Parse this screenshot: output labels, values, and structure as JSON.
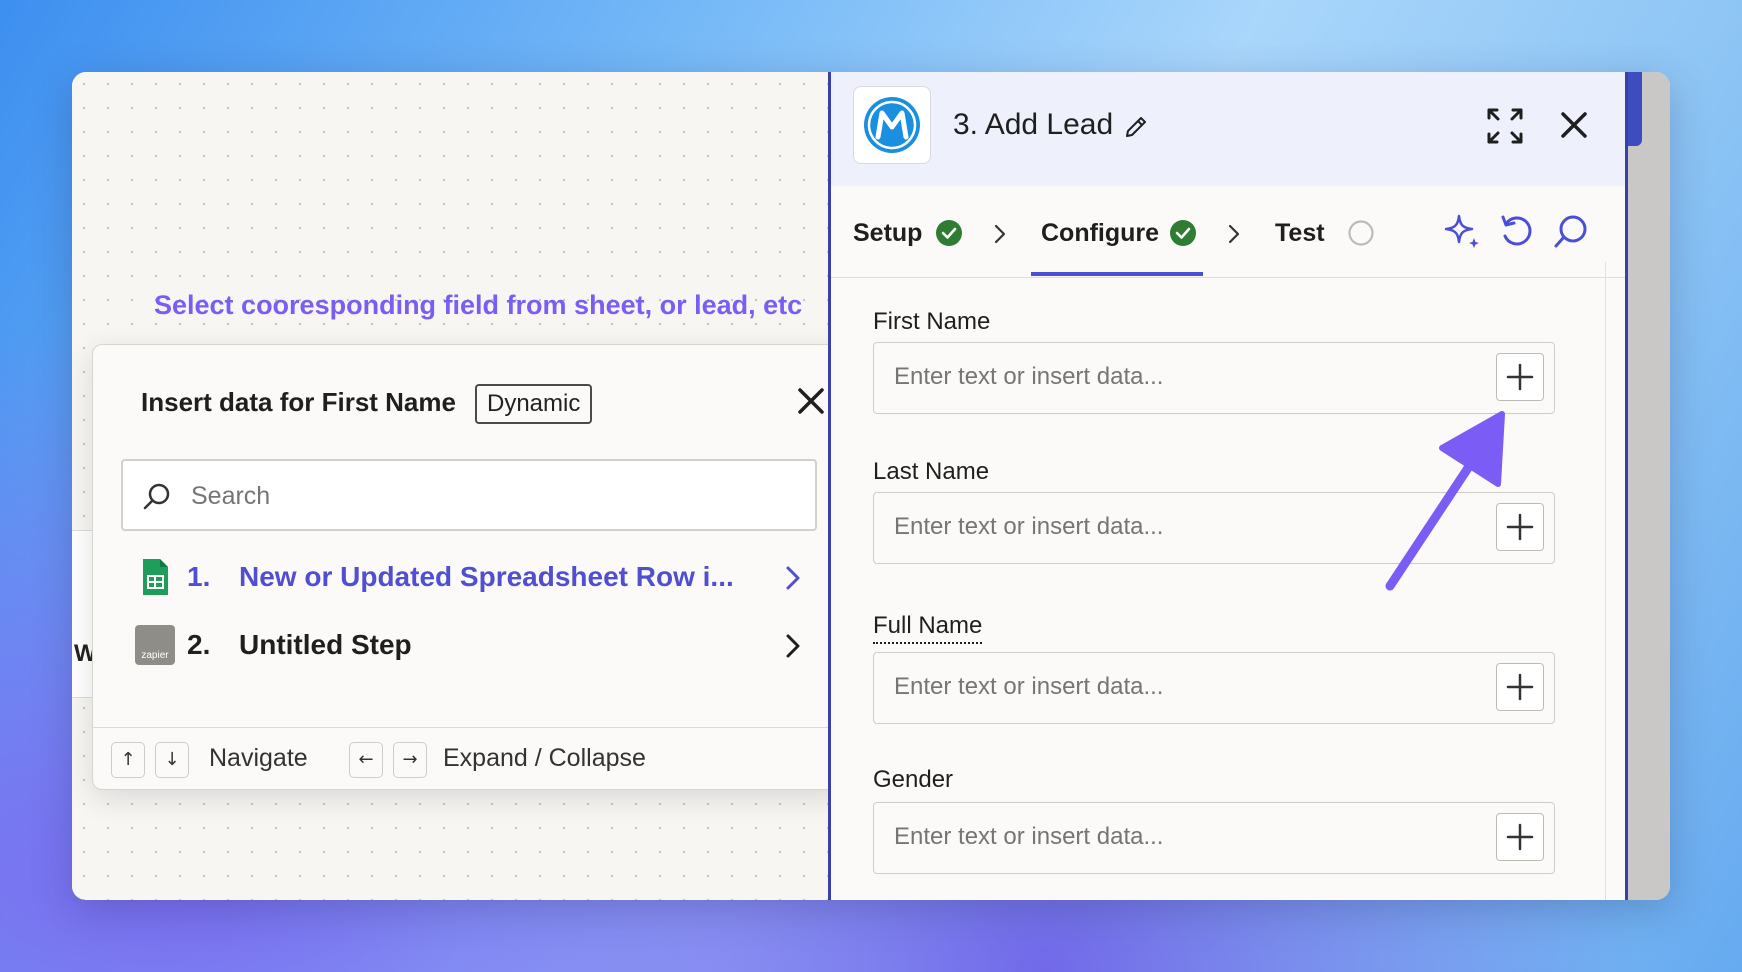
{
  "canvas": {
    "hint": "Select cooresponding field from sheet, or lead, etc",
    "stub_letter": "W"
  },
  "popup": {
    "title": "Insert data for First Name",
    "badge": "Dynamic",
    "search_placeholder": "Search",
    "items": [
      {
        "number": "1.",
        "label": "New or Updated Spreadsheet Row i...",
        "icon": "google-sheets-icon",
        "color": "#4f4fd0"
      },
      {
        "number": "2.",
        "label": "Untitled Step",
        "icon": "zapier-icon",
        "icon_text": "zapier",
        "color": "#1f1f1f"
      }
    ],
    "footer": {
      "up_key": "↑",
      "down_key": "↓",
      "navigate": "Navigate",
      "left_key": "←",
      "right_key": "→",
      "expand": "Expand / Collapse"
    }
  },
  "panel": {
    "title": "3. Add Lead",
    "tabs": [
      {
        "label": "Setup",
        "status": "complete"
      },
      {
        "label": "Configure",
        "status": "complete",
        "active": true
      },
      {
        "label": "Test",
        "status": "pending"
      }
    ],
    "fields": [
      {
        "label": "First Name",
        "placeholder": "Enter text or insert data..."
      },
      {
        "label": "Last Name",
        "placeholder": "Enter text or insert data..."
      },
      {
        "label": "Full Name",
        "placeholder": "Enter text or insert data..."
      },
      {
        "label": "Gender",
        "placeholder": "Enter text or insert data..."
      }
    ]
  },
  "colors": {
    "accent": "#4b4fd6",
    "hint": "#7b5cf5",
    "check_green": "#2e7d32",
    "arrow": "#7b5cf5"
  }
}
